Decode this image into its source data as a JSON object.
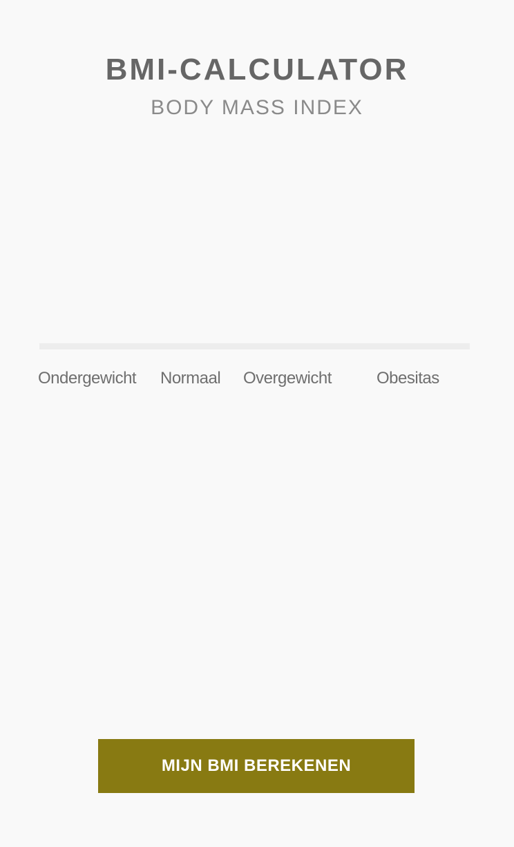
{
  "header": {
    "title": "BMI-CALCULATOR",
    "subtitle": "BODY MASS INDEX"
  },
  "scale": {
    "categories": [
      {
        "label": "Ondergewicht"
      },
      {
        "label": "Normaal"
      },
      {
        "label": "Overgewicht"
      },
      {
        "label": "Obesitas"
      }
    ],
    "track_color": "#ededed",
    "progress": 0
  },
  "actions": {
    "calculate_label": "MIJN BMI BEREKENEN",
    "button_color": "#887a12"
  }
}
